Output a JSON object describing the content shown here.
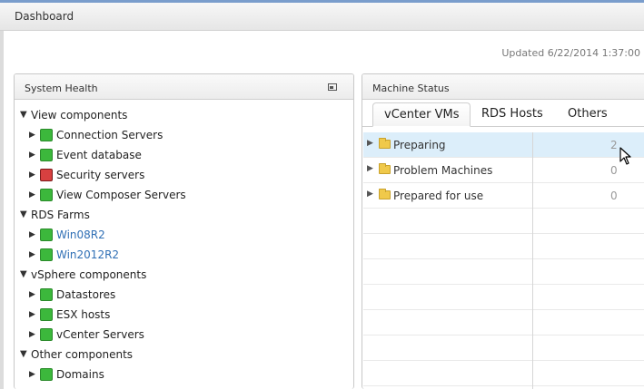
{
  "header": {
    "title": "Dashboard"
  },
  "updated": "Updated 6/22/2014 1:37:00",
  "system_health": {
    "title": "System Health",
    "groups": [
      {
        "label": "View components",
        "items": [
          {
            "label": "Connection Servers",
            "status": "green"
          },
          {
            "label": "Event database",
            "status": "green"
          },
          {
            "label": "Security servers",
            "status": "red"
          },
          {
            "label": "View Composer Servers",
            "status": "green"
          }
        ]
      },
      {
        "label": "RDS Farms",
        "items": [
          {
            "label": "Win08R2",
            "status": "green"
          },
          {
            "label": "Win2012R2",
            "status": "green"
          }
        ]
      },
      {
        "label": "vSphere components",
        "items": [
          {
            "label": "Datastores",
            "status": "green"
          },
          {
            "label": "ESX hosts",
            "status": "green"
          },
          {
            "label": "vCenter Servers",
            "status": "green"
          }
        ]
      },
      {
        "label": "Other components",
        "items": [
          {
            "label": "Domains",
            "status": "green"
          }
        ]
      }
    ]
  },
  "machine_status": {
    "title": "Machine Status",
    "tabs": [
      "vCenter VMs",
      "RDS Hosts",
      "Others"
    ],
    "active_tab": "vCenter VMs",
    "rows": [
      {
        "label": "Preparing",
        "count": "2"
      },
      {
        "label": "Problem Machines",
        "count": "0"
      },
      {
        "label": "Prepared for use",
        "count": "0"
      }
    ]
  },
  "colors": {
    "green": "#3cb83c",
    "red": "#d84040",
    "link": "#2f6fb5",
    "selected_row": "#dceefa"
  },
  "icons": [
    "collapse-icon",
    "expand-triangle-icon",
    "folder-icon",
    "status-square-icon",
    "mouse-cursor-icon"
  ]
}
